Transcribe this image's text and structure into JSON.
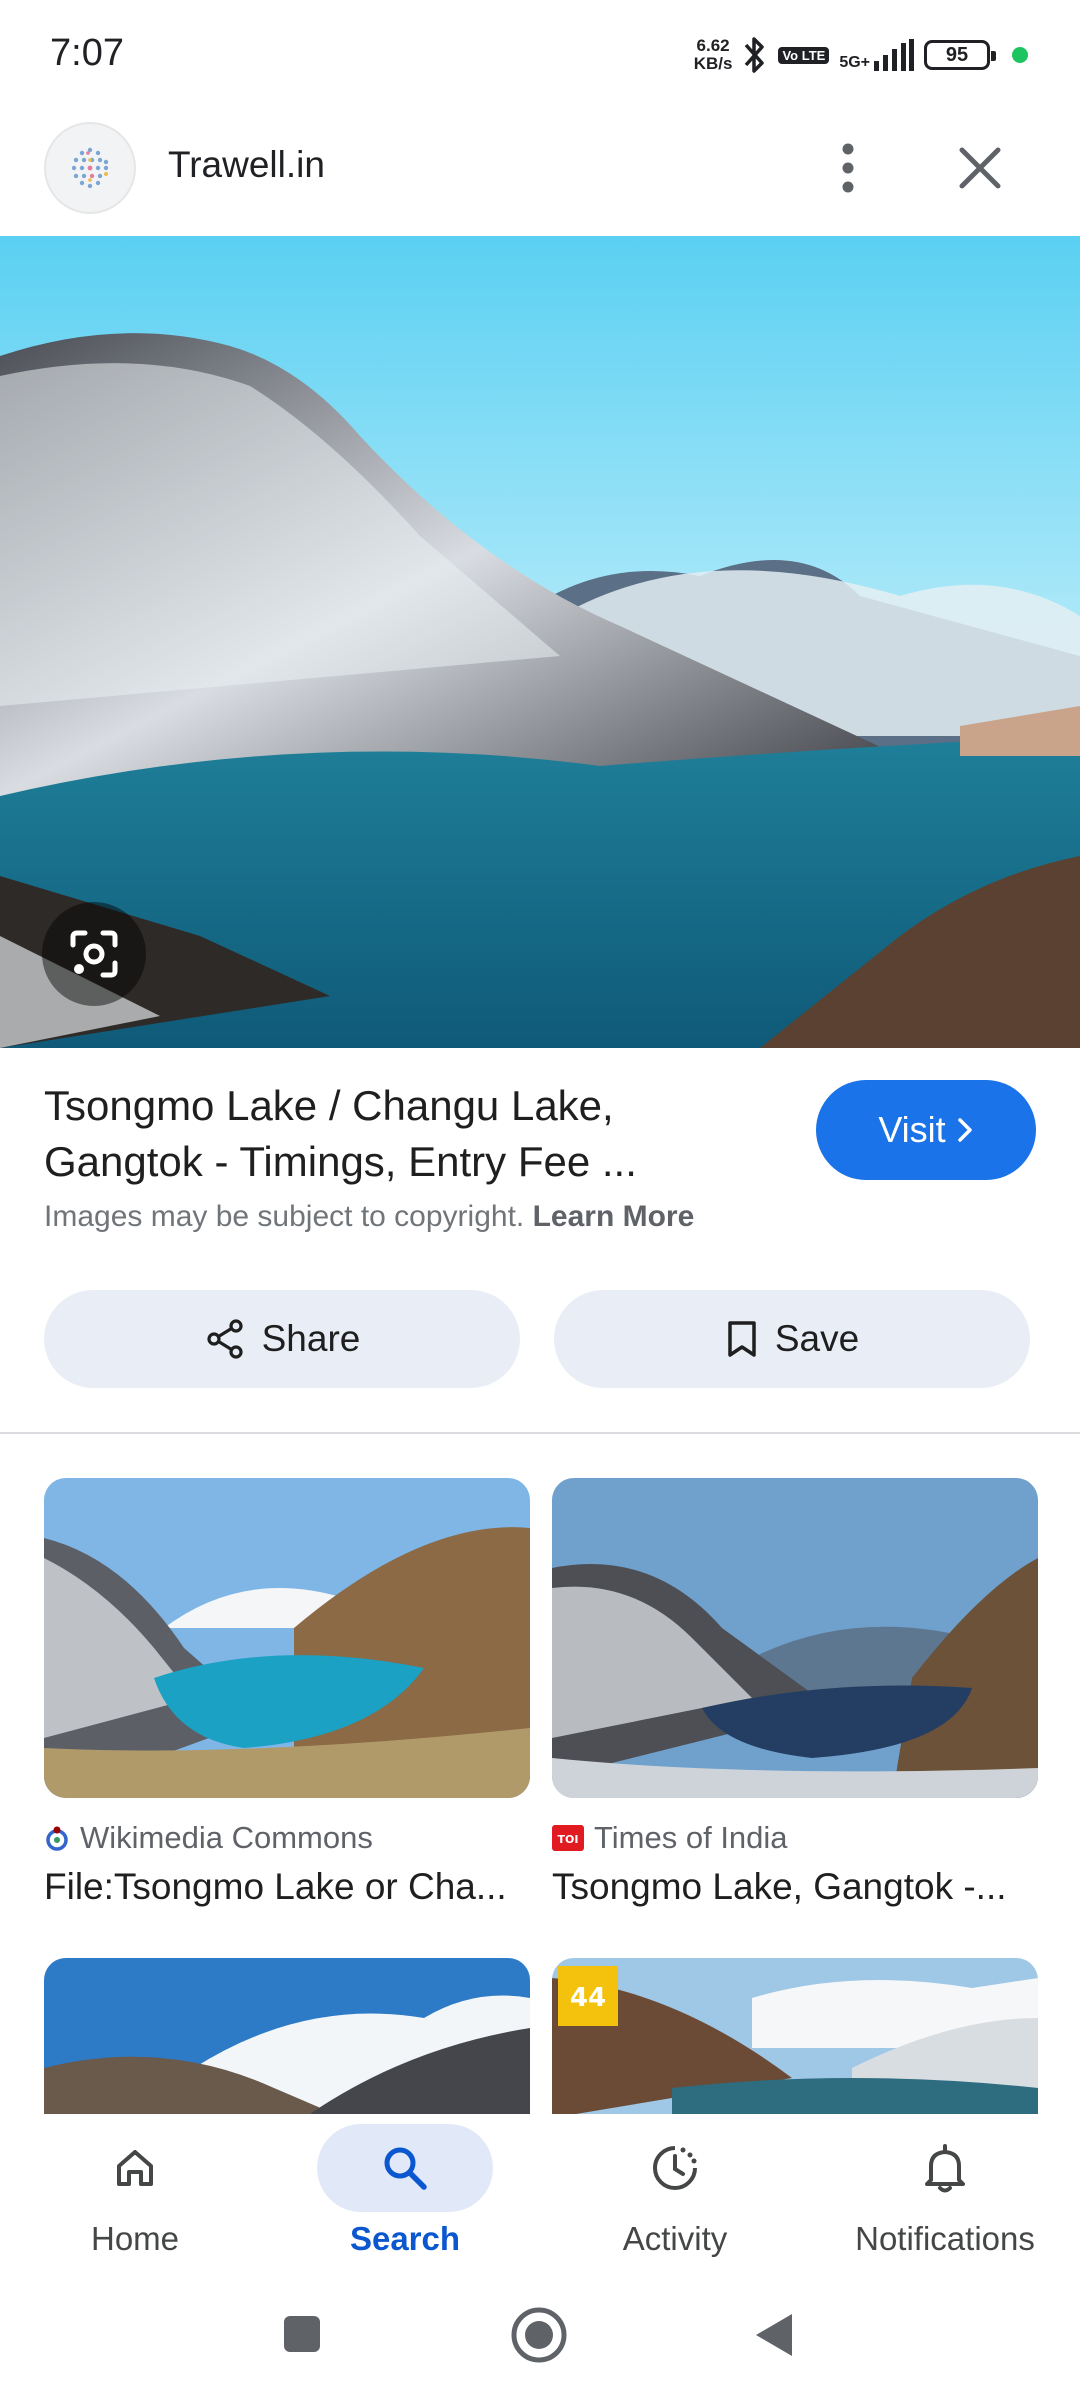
{
  "status_bar": {
    "time": "7:07",
    "net_speed_value": "6.62",
    "net_speed_unit": "KB/s",
    "volte": "Vo LTE",
    "network": "5G+",
    "battery": "95",
    "icons": [
      "bluetooth-icon",
      "signal-icon",
      "battery-icon"
    ]
  },
  "header": {
    "site_name": "Trawell.in",
    "icons": [
      "site-logo-icon",
      "more-vert-icon",
      "close-icon"
    ]
  },
  "result": {
    "title_line1": "Tsongmo Lake / Changu Lake,",
    "title_line2": "Gangtok - Timings, Entry Fee ...",
    "copyright_text": "Images may be subject to copyright.",
    "learn_more": "Learn More",
    "visit_label": "Visit"
  },
  "actions": {
    "share_label": "Share",
    "save_label": "Save"
  },
  "grid": [
    {
      "source": "Wikimedia Commons",
      "title": "File:Tsongmo Lake or Cha...",
      "source_icon": "wikimedia-icon"
    },
    {
      "source": "Times of India",
      "title": "Tsongmo Lake, Gangtok -...",
      "source_icon": "toi-icon"
    },
    {
      "badge": "",
      "source_icon": ""
    },
    {
      "badge": "44",
      "source_icon": ""
    }
  ],
  "bottom_nav": [
    {
      "label": "Home",
      "icon": "home-icon",
      "active": false
    },
    {
      "label": "Search",
      "icon": "search-icon",
      "active": true
    },
    {
      "label": "Activity",
      "icon": "activity-icon",
      "active": false
    },
    {
      "label": "Notifications",
      "icon": "bell-icon",
      "active": false
    }
  ],
  "colors": {
    "accent": "#1a73e8",
    "active_nav": "#0b57d0",
    "chip_bg": "#e9eef6"
  }
}
